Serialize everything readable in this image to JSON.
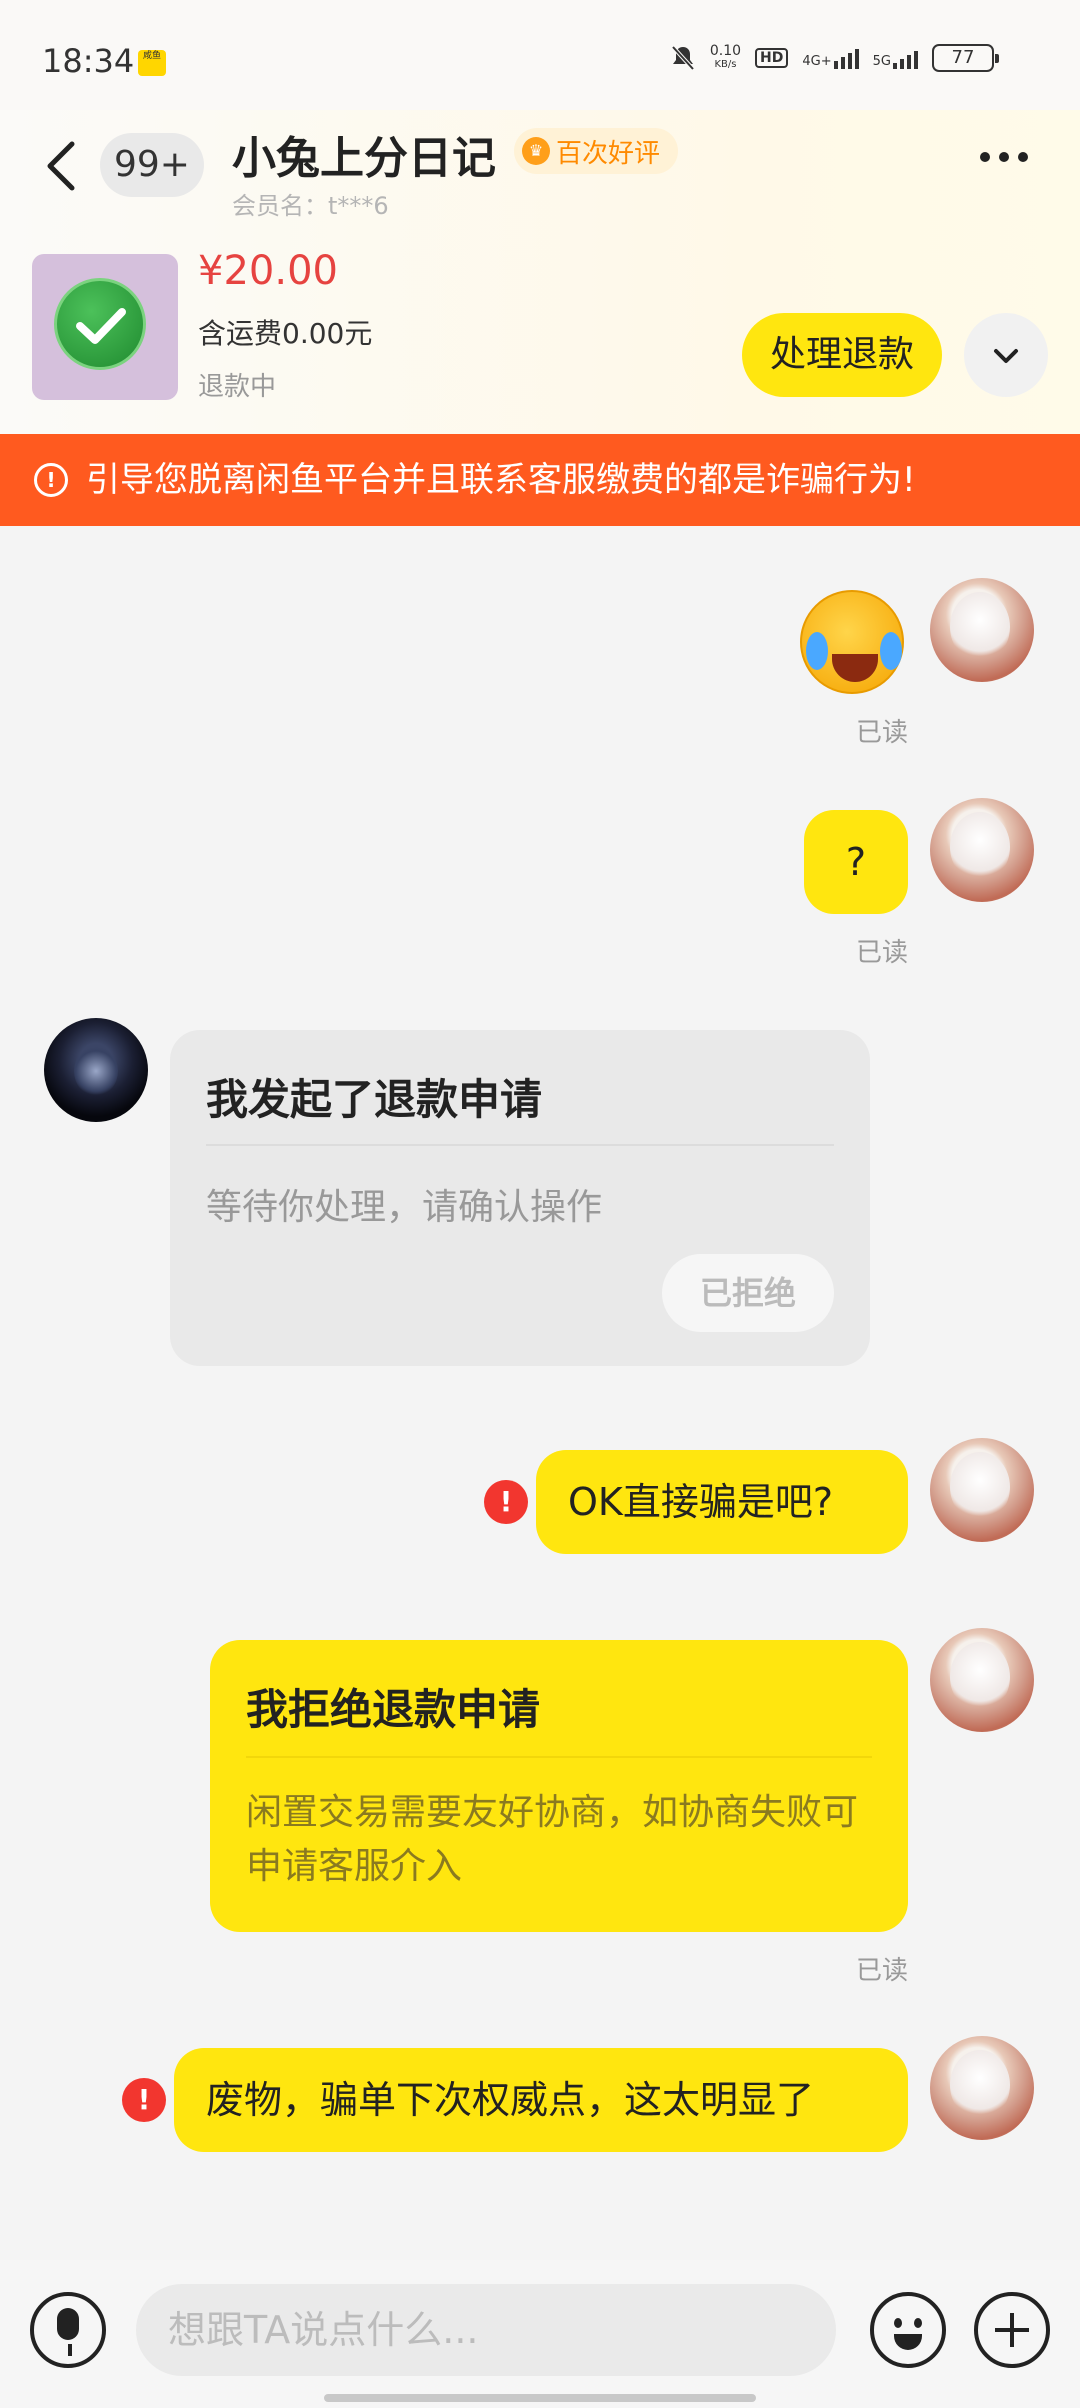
{
  "status_bar": {
    "time": "18:34",
    "net_speed": "0.10",
    "net_unit": "KB/s",
    "hd": "HD",
    "net1": "4G+",
    "net2": "5G",
    "battery": "77",
    "app_notice": "咸鱼"
  },
  "header": {
    "unread_count": "99+",
    "title": "小兔上分日记",
    "badge": "百次好评",
    "member_label": "会员名：t***6"
  },
  "product": {
    "price": "¥20.00",
    "shipping": "含运费0.00元",
    "status": "退款中",
    "action_label": "处理退款"
  },
  "warning": {
    "text": "引导您脱离闲鱼平台并且联系客服缴费的都是诈骗行为!"
  },
  "messages": {
    "read_label": "已读",
    "q_text": "?",
    "refund_request": {
      "title": "我发起了退款申请",
      "body": "等待你处理，请确认操作",
      "button": "已拒绝"
    },
    "ok_text": "OK直接骗是吧?",
    "reject_card": {
      "title": "我拒绝退款申请",
      "body": "闲置交易需要友好协商，如协商失败可申请客服介入"
    },
    "last_text": "废物，骗单下次权威点，这太明显了"
  },
  "input_bar": {
    "placeholder": "想跟TA说点什么..."
  },
  "colors": {
    "accent_yellow": "#ffe60f",
    "warning_orange": "#ff5a1f",
    "price_red": "#e64340",
    "error_red": "#f2362f"
  }
}
